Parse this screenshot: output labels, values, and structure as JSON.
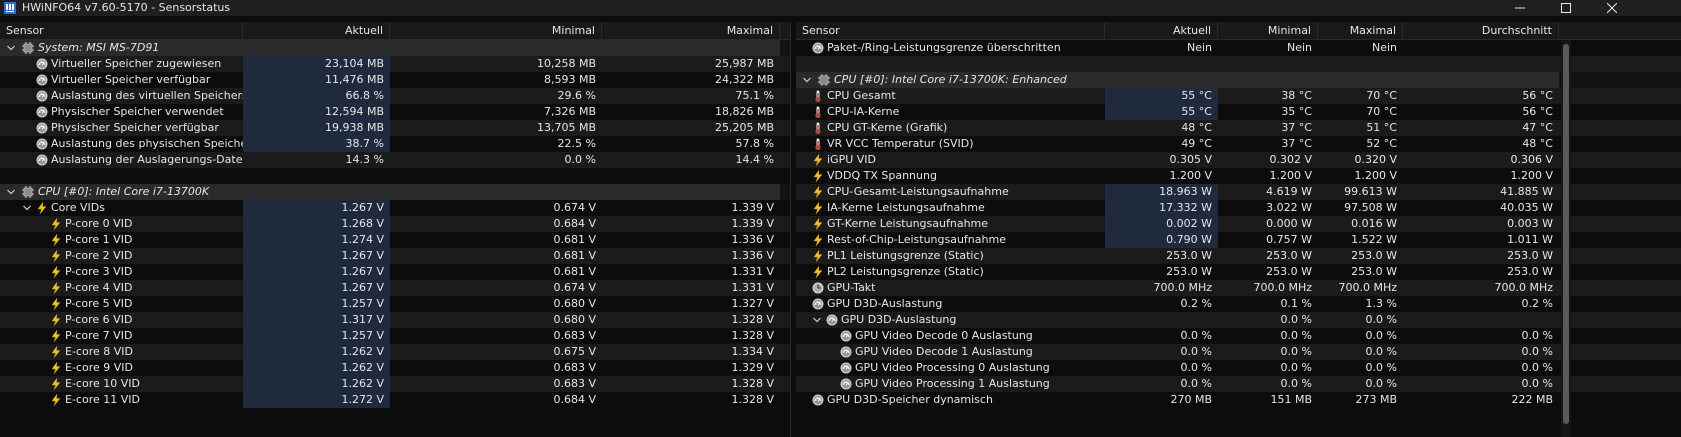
{
  "window": {
    "title": "HWiNFO64 v7.60-5170 - Sensorstatus"
  },
  "colors": {
    "background": "#0c0c0c",
    "header": "#191919",
    "highlight": "#1f2b3d",
    "bolt": "#f5c518",
    "thermo_red": "#d23b2f"
  },
  "left": {
    "headers": [
      "Sensor",
      "Aktuell",
      "Minimal",
      "Maximal"
    ],
    "rows": [
      {
        "type": "group",
        "label": "System: MSI MS-7D91",
        "icon": "chip-icon"
      },
      {
        "type": "data",
        "indent": 1,
        "icon": "gauge-icon",
        "label": "Virtueller Speicher zugewiesen",
        "cur": "23,104 MB",
        "min": "10,258 MB",
        "max": "25,987 MB",
        "hl": true
      },
      {
        "type": "data",
        "indent": 1,
        "icon": "gauge-icon",
        "label": "Virtueller Speicher verfügbar",
        "cur": "11,476 MB",
        "min": "8,593 MB",
        "max": "24,322 MB",
        "hl": true
      },
      {
        "type": "data",
        "indent": 1,
        "icon": "gauge-icon",
        "label": "Auslastung des virtuellen Speichers",
        "cur": "66.8 %",
        "min": "29.6 %",
        "max": "75.1 %",
        "hl": true
      },
      {
        "type": "data",
        "indent": 1,
        "icon": "gauge-icon",
        "label": "Physischer Speicher verwendet",
        "cur": "12,594 MB",
        "min": "7,326 MB",
        "max": "18,826 MB",
        "hl": true
      },
      {
        "type": "data",
        "indent": 1,
        "icon": "gauge-icon",
        "label": "Physischer Speicher verfügbar",
        "cur": "19,938 MB",
        "min": "13,705 MB",
        "max": "25,205 MB",
        "hl": true
      },
      {
        "type": "data",
        "indent": 1,
        "icon": "gauge-icon",
        "label": "Auslastung des physischen Speichers",
        "cur": "38.7 %",
        "min": "22.5 %",
        "max": "57.8 %",
        "hl": true
      },
      {
        "type": "data",
        "indent": 1,
        "icon": "gauge-icon",
        "label": "Auslastung der Auslagerungs-Datei",
        "cur": "14.3 %",
        "min": "0.0 %",
        "max": "14.4 %",
        "hl": false
      },
      {
        "type": "blank"
      },
      {
        "type": "group",
        "label": "CPU [#0]: Intel Core i7-13700K",
        "icon": "chip-icon"
      },
      {
        "type": "data",
        "indent": 1,
        "chev": true,
        "icon": "bolt-icon",
        "label": "Core VIDs",
        "cur": "1.267 V",
        "min": "0.674 V",
        "max": "1.339 V",
        "hl": true
      },
      {
        "type": "data",
        "indent": 2,
        "icon": "bolt-icon",
        "label": "P-core 0 VID",
        "cur": "1.268 V",
        "min": "0.684 V",
        "max": "1.339 V",
        "hl": true
      },
      {
        "type": "data",
        "indent": 2,
        "icon": "bolt-icon",
        "label": "P-core 1 VID",
        "cur": "1.274 V",
        "min": "0.681 V",
        "max": "1.336 V",
        "hl": true
      },
      {
        "type": "data",
        "indent": 2,
        "icon": "bolt-icon",
        "label": "P-core 2 VID",
        "cur": "1.267 V",
        "min": "0.681 V",
        "max": "1.336 V",
        "hl": true
      },
      {
        "type": "data",
        "indent": 2,
        "icon": "bolt-icon",
        "label": "P-core 3 VID",
        "cur": "1.267 V",
        "min": "0.681 V",
        "max": "1.331 V",
        "hl": true
      },
      {
        "type": "data",
        "indent": 2,
        "icon": "bolt-icon",
        "label": "P-core 4 VID",
        "cur": "1.267 V",
        "min": "0.674 V",
        "max": "1.331 V",
        "hl": true
      },
      {
        "type": "data",
        "indent": 2,
        "icon": "bolt-icon",
        "label": "P-core 5 VID",
        "cur": "1.257 V",
        "min": "0.680 V",
        "max": "1.327 V",
        "hl": true
      },
      {
        "type": "data",
        "indent": 2,
        "icon": "bolt-icon",
        "label": "P-core 6 VID",
        "cur": "1.317 V",
        "min": "0.680 V",
        "max": "1.328 V",
        "hl": true
      },
      {
        "type": "data",
        "indent": 2,
        "icon": "bolt-icon",
        "label": "P-core 7 VID",
        "cur": "1.257 V",
        "min": "0.683 V",
        "max": "1.328 V",
        "hl": true
      },
      {
        "type": "data",
        "indent": 2,
        "icon": "bolt-icon",
        "label": "E-core 8 VID",
        "cur": "1.262 V",
        "min": "0.675 V",
        "max": "1.334 V",
        "hl": true
      },
      {
        "type": "data",
        "indent": 2,
        "icon": "bolt-icon",
        "label": "E-core 9 VID",
        "cur": "1.262 V",
        "min": "0.683 V",
        "max": "1.329 V",
        "hl": true
      },
      {
        "type": "data",
        "indent": 2,
        "icon": "bolt-icon",
        "label": "E-core 10 VID",
        "cur": "1.262 V",
        "min": "0.683 V",
        "max": "1.328 V",
        "hl": true
      },
      {
        "type": "data",
        "indent": 2,
        "icon": "bolt-icon",
        "label": "E-core 11 VID",
        "cur": "1.272 V",
        "min": "0.684 V",
        "max": "1.328 V",
        "hl": true
      }
    ]
  },
  "right": {
    "headers": [
      "Sensor",
      "Aktuell",
      "Minimal",
      "Maximal",
      "Durchschnitt"
    ],
    "rows": [
      {
        "type": "data",
        "indent": 0,
        "icon": "gauge-icon",
        "label": "Paket-/Ring-Leistungsgrenze überschritten",
        "cur": "Nein",
        "min": "Nein",
        "max": "Nein",
        "avg": "",
        "hl": false
      },
      {
        "type": "blank"
      },
      {
        "type": "group",
        "label": "CPU [#0]: Intel Core i7-13700K: Enhanced",
        "icon": "chip-icon"
      },
      {
        "type": "data",
        "indent": 0,
        "icon": "thermometer-icon",
        "label": "CPU Gesamt",
        "cur": "55 °C",
        "min": "38 °C",
        "max": "70 °C",
        "avg": "56 °C",
        "hl": true
      },
      {
        "type": "data",
        "indent": 0,
        "icon": "thermometer-icon",
        "label": "CPU-IA-Kerne",
        "cur": "55 °C",
        "min": "35 °C",
        "max": "70 °C",
        "avg": "56 °C",
        "hl": true
      },
      {
        "type": "data",
        "indent": 0,
        "icon": "thermometer-icon",
        "label": "CPU GT-Kerne (Grafik)",
        "cur": "48 °C",
        "min": "37 °C",
        "max": "51 °C",
        "avg": "47 °C",
        "hl": false
      },
      {
        "type": "data",
        "indent": 0,
        "icon": "thermometer-icon",
        "label": "VR VCC Temperatur (SVID)",
        "cur": "49 °C",
        "min": "37 °C",
        "max": "52 °C",
        "avg": "48 °C",
        "hl": false
      },
      {
        "type": "data",
        "indent": 0,
        "icon": "bolt-icon",
        "label": "iGPU VID",
        "cur": "0.305 V",
        "min": "0.302 V",
        "max": "0.320 V",
        "avg": "0.306 V",
        "hl": false
      },
      {
        "type": "data",
        "indent": 0,
        "icon": "bolt-icon",
        "label": "VDDQ TX Spannung",
        "cur": "1.200 V",
        "min": "1.200 V",
        "max": "1.200 V",
        "avg": "1.200 V",
        "hl": false
      },
      {
        "type": "data",
        "indent": 0,
        "icon": "bolt-icon",
        "label": "CPU-Gesamt-Leistungsaufnahme",
        "cur": "18.963 W",
        "min": "4.619 W",
        "max": "99.613 W",
        "avg": "41.885 W",
        "hl": true
      },
      {
        "type": "data",
        "indent": 0,
        "icon": "bolt-icon",
        "label": "IA-Kerne Leistungsaufnahme",
        "cur": "17.332 W",
        "min": "3.022 W",
        "max": "97.508 W",
        "avg": "40.035 W",
        "hl": true
      },
      {
        "type": "data",
        "indent": 0,
        "icon": "bolt-icon",
        "label": "GT-Kerne Leistungsaufnahme",
        "cur": "0.002 W",
        "min": "0.000 W",
        "max": "0.016 W",
        "avg": "0.003 W",
        "hl": true
      },
      {
        "type": "data",
        "indent": 0,
        "icon": "bolt-icon",
        "label": "Rest-of-Chip-Leistungsaufnahme",
        "cur": "0.790 W",
        "min": "0.757 W",
        "max": "1.522 W",
        "avg": "1.011 W",
        "hl": true
      },
      {
        "type": "data",
        "indent": 0,
        "icon": "bolt-icon",
        "label": "PL1 Leistungsgrenze (Static)",
        "cur": "253.0 W",
        "min": "253.0 W",
        "max": "253.0 W",
        "avg": "253.0 W",
        "hl": false
      },
      {
        "type": "data",
        "indent": 0,
        "icon": "bolt-icon",
        "label": "PL2 Leistungsgrenze (Static)",
        "cur": "253.0 W",
        "min": "253.0 W",
        "max": "253.0 W",
        "avg": "253.0 W",
        "hl": false
      },
      {
        "type": "data",
        "indent": 0,
        "icon": "clock-icon",
        "label": "GPU-Takt",
        "cur": "700.0 MHz",
        "min": "700.0 MHz",
        "max": "700.0 MHz",
        "avg": "700.0 MHz",
        "hl": false
      },
      {
        "type": "data",
        "indent": 0,
        "icon": "gauge-icon",
        "label": "GPU D3D-Auslastung",
        "cur": "0.2 %",
        "min": "0.1 %",
        "max": "1.3 %",
        "avg": "0.2 %",
        "hl": false
      },
      {
        "type": "data",
        "indent": 1,
        "chev": true,
        "icon": "gauge-icon",
        "label": "GPU D3D-Auslastung",
        "cur": "",
        "min": "0.0 %",
        "max": "0.0 %",
        "avg": "",
        "hl": false
      },
      {
        "type": "data",
        "indent": 2,
        "icon": "gauge-icon",
        "label": "GPU Video Decode 0 Auslastung",
        "cur": "0.0 %",
        "min": "0.0 %",
        "max": "0.0 %",
        "avg": "0.0 %",
        "hl": false
      },
      {
        "type": "data",
        "indent": 2,
        "icon": "gauge-icon",
        "label": "GPU Video Decode 1 Auslastung",
        "cur": "0.0 %",
        "min": "0.0 %",
        "max": "0.0 %",
        "avg": "0.0 %",
        "hl": false
      },
      {
        "type": "data",
        "indent": 2,
        "icon": "gauge-icon",
        "label": "GPU Video Processing 0 Auslastung",
        "cur": "0.0 %",
        "min": "0.0 %",
        "max": "0.0 %",
        "avg": "0.0 %",
        "hl": false
      },
      {
        "type": "data",
        "indent": 2,
        "icon": "gauge-icon",
        "label": "GPU Video Processing 1 Auslastung",
        "cur": "0.0 %",
        "min": "0.0 %",
        "max": "0.0 %",
        "avg": "0.0 %",
        "hl": false
      },
      {
        "type": "data",
        "indent": 0,
        "icon": "gauge-icon",
        "label": "GPU D3D-Speicher dynamisch",
        "cur": "270 MB",
        "min": "151 MB",
        "max": "273 MB",
        "avg": "222 MB",
        "hl": false
      }
    ]
  }
}
